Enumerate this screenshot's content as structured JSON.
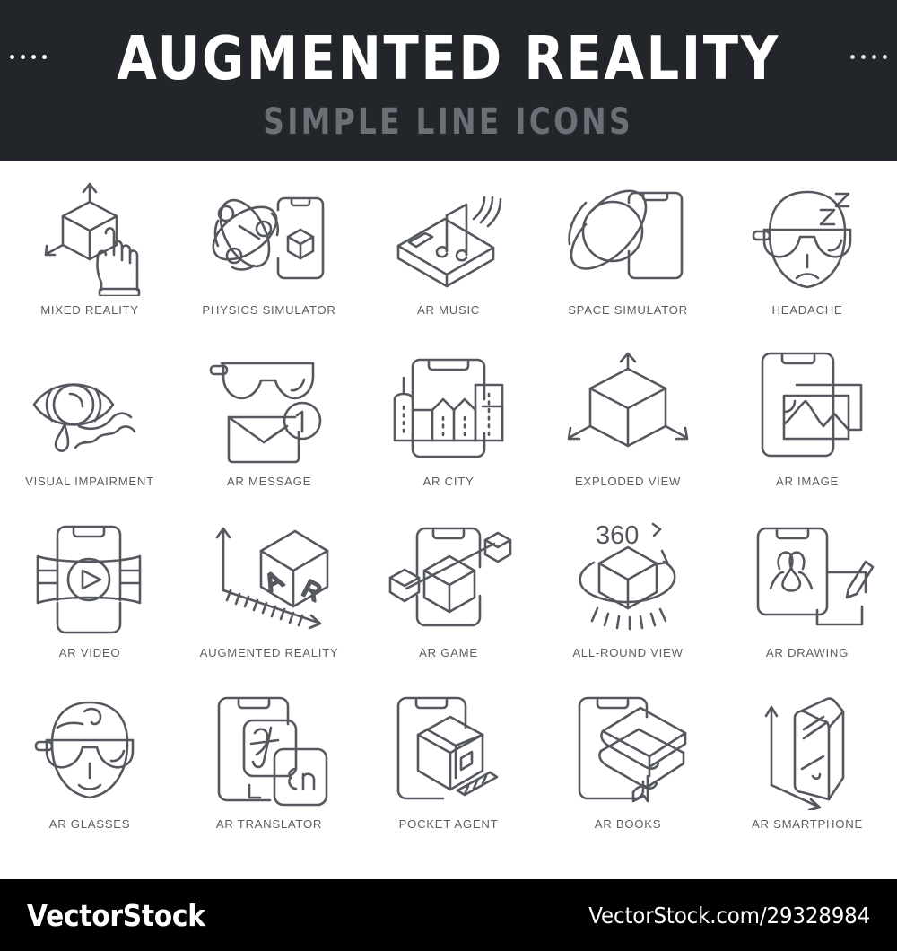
{
  "header": {
    "title": "AUGMENTED REALITY",
    "subtitle": "SIMPLE LINE ICONS",
    "background_color": "#22252a",
    "title_color": "#ffffff",
    "subtitle_color": "#6c7076",
    "left_dots": 4,
    "right_dots": 4
  },
  "icons": [
    {
      "id": "mixed-reality",
      "label": "MIXED REALITY",
      "glyph": "cube-arrows-hand"
    },
    {
      "id": "physics-simulator",
      "label": "PHYSICS SIMULATOR",
      "glyph": "atom-phone-cube"
    },
    {
      "id": "ar-music",
      "label": "AR MUSIC",
      "glyph": "phone-music-note"
    },
    {
      "id": "space-simulator",
      "label": "SPACE SIMULATOR",
      "glyph": "planet-phone"
    },
    {
      "id": "headache",
      "label": "HEADACHE",
      "glyph": "head-glasses-zzz"
    },
    {
      "id": "visual-impairment",
      "label": "VISUAL IMPAIRMENT",
      "glyph": "eye-tear"
    },
    {
      "id": "ar-message",
      "label": "AR MESSAGE",
      "glyph": "glasses-envelope-badge"
    },
    {
      "id": "ar-city",
      "label": "AR CITY",
      "glyph": "phone-city"
    },
    {
      "id": "exploded-view",
      "label": "EXPLODED VIEW",
      "glyph": "cube-three-axes"
    },
    {
      "id": "ar-image",
      "label": "AR IMAGE",
      "glyph": "phone-photos"
    },
    {
      "id": "ar-video",
      "label": "AR VIDEO",
      "glyph": "phone-film-play"
    },
    {
      "id": "augmented-reality",
      "label": "AUGMENTED REALITY",
      "glyph": "cube-ar-axes"
    },
    {
      "id": "ar-game",
      "label": "AR GAME",
      "glyph": "phone-cubes-link"
    },
    {
      "id": "all-round-view",
      "label": "ALL-ROUND VIEW",
      "glyph": "cube-360-rotate"
    },
    {
      "id": "ar-drawing",
      "label": "AR DRAWING",
      "glyph": "phone-pen-sketch"
    },
    {
      "id": "ar-glasses",
      "label": "AR GLASSES",
      "glyph": "head-ar-glasses"
    },
    {
      "id": "ar-translator",
      "label": "AR TRANSLATOR",
      "glyph": "phone-translate-cards"
    },
    {
      "id": "pocket-agent",
      "label": "POCKET AGENT",
      "glyph": "phone-house-3d"
    },
    {
      "id": "ar-books",
      "label": "AR BOOKS",
      "glyph": "phone-books-3d"
    },
    {
      "id": "ar-smartphone",
      "label": "AR SMARTPHONE",
      "glyph": "phone-3d-axes"
    }
  ],
  "icon_annotations": {
    "ar_message_badge": "1",
    "all_round_view_label": "360",
    "augmented_reality_cube_text": "AR",
    "ar_translator_front_text": "En"
  },
  "footer": {
    "brand": "VectorStock",
    "url": "VectorStock.com/29328984",
    "background_color": "#000000",
    "text_color": "#ffffff"
  },
  "colors": {
    "page_background": "#ffffff",
    "icon_stroke": "#55595f",
    "caption": "#5a5f66"
  }
}
